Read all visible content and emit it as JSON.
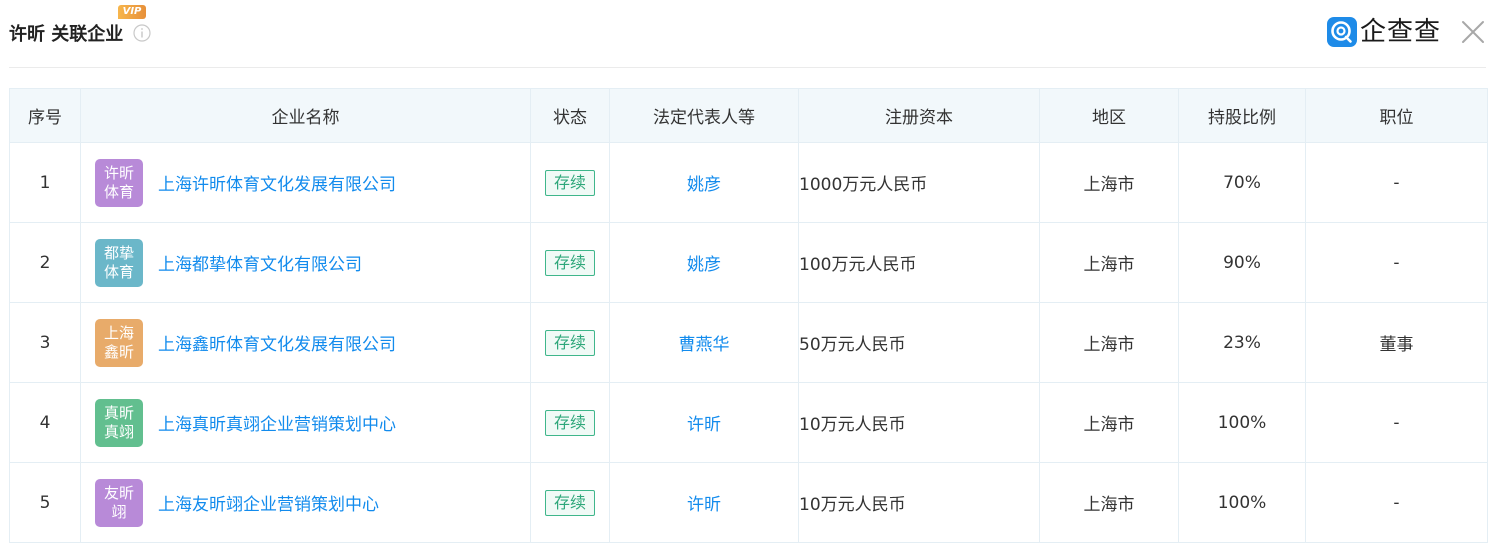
{
  "header": {
    "title": "许昕 关联企业",
    "vip_badge": "VIP",
    "logo_text": "企查查",
    "info_icon": "info-circle-icon",
    "close_icon": "close-icon"
  },
  "table": {
    "columns": [
      "序号",
      "企业名称",
      "状态",
      "法定代表人等",
      "注册资本",
      "地区",
      "持股比例",
      "职位"
    ],
    "rows": [
      {
        "index": "1",
        "avatar": [
          "许昕",
          "体育"
        ],
        "avatar_color": "#b88ad8",
        "company": "上海许昕体育文化发展有限公司",
        "status": "存续",
        "representative": "姚彦",
        "capital": "1000万元人民币",
        "region": "上海市",
        "share": "70%",
        "position": "-"
      },
      {
        "index": "2",
        "avatar": [
          "都挚",
          "体育"
        ],
        "avatar_color": "#6bb7c9",
        "company": "上海都挚体育文化有限公司",
        "status": "存续",
        "representative": "姚彦",
        "capital": "100万元人民币",
        "region": "上海市",
        "share": "90%",
        "position": "-"
      },
      {
        "index": "3",
        "avatar": [
          "上海",
          "鑫昕"
        ],
        "avatar_color": "#e8ab6a",
        "company": "上海鑫昕体育文化发展有限公司",
        "status": "存续",
        "representative": "曹燕华",
        "capital": "50万元人民币",
        "region": "上海市",
        "share": "23%",
        "position": "董事"
      },
      {
        "index": "4",
        "avatar": [
          "真昕",
          "真翊"
        ],
        "avatar_color": "#62bf8f",
        "company": "上海真昕真翊企业营销策划中心",
        "status": "存续",
        "representative": "许昕",
        "capital": "10万元人民币",
        "region": "上海市",
        "share": "100%",
        "position": "-"
      },
      {
        "index": "5",
        "avatar": [
          "友昕",
          "翊"
        ],
        "avatar_color": "#b88ad8",
        "company": "上海友昕翊企业营销策划中心",
        "status": "存续",
        "representative": "许昕",
        "capital": "10万元人民币",
        "region": "上海市",
        "share": "100%",
        "position": "-"
      }
    ]
  },
  "colors": {
    "link": "#128bed",
    "status_green": "#2ea77a",
    "header_bg": "#f2f8fb",
    "brand": "#1e8be8"
  }
}
